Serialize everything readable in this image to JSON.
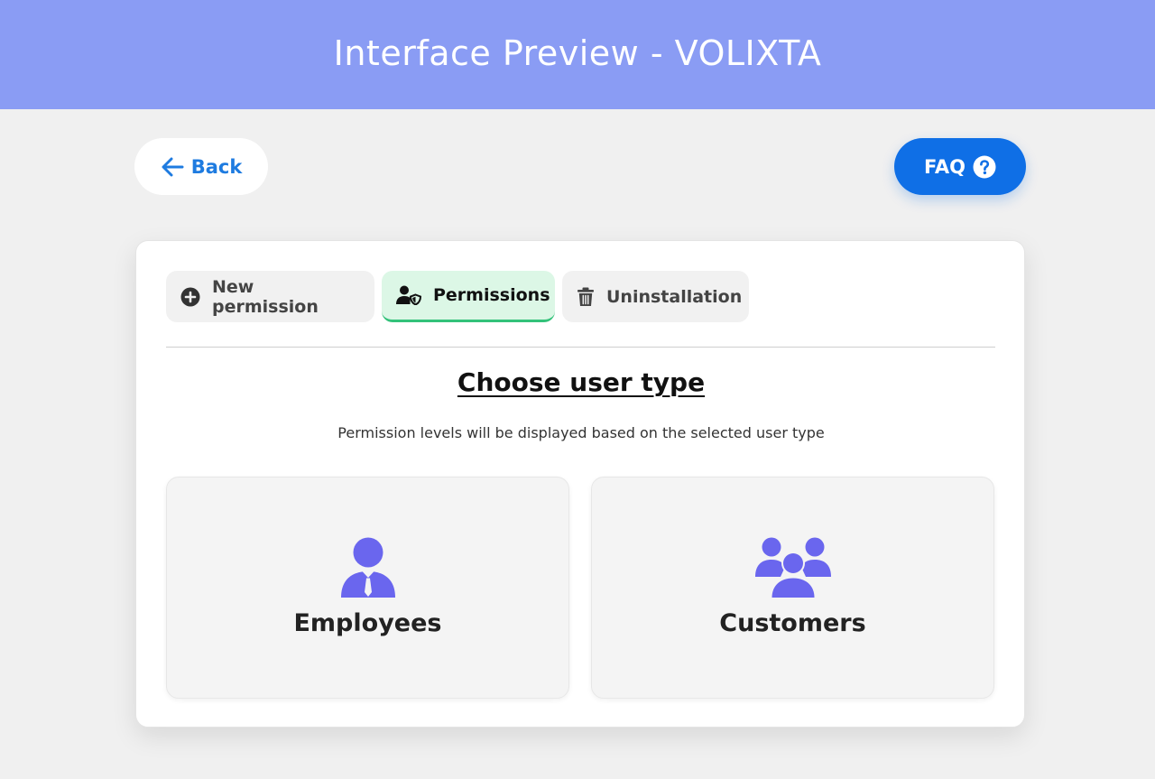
{
  "header": {
    "title": "Interface Preview - VOLIXTA"
  },
  "nav": {
    "back_label": "Back",
    "faq_label": "FAQ"
  },
  "tabs": [
    {
      "label": "New permission",
      "icon": "plus-circle-icon",
      "active": false
    },
    {
      "label": "Permissions",
      "icon": "user-shield-icon",
      "active": true
    },
    {
      "label": "Uninstallation",
      "icon": "trash-icon",
      "active": false
    }
  ],
  "main": {
    "title": "Choose user type",
    "subtitle": "Permission levels will be displayed based on the selected user type"
  },
  "user_types": [
    {
      "label": "Employees",
      "icon": "employee-icon"
    },
    {
      "label": "Customers",
      "icon": "customers-group-icon"
    }
  ],
  "colors": {
    "header_bg": "#8a9cf4",
    "accent_blue": "#0f6fe6",
    "link_blue": "#1e7be0",
    "active_tab_bg": "#dcf7e6",
    "active_tab_border": "#33c27a",
    "user_icon": "#6a66ee"
  }
}
